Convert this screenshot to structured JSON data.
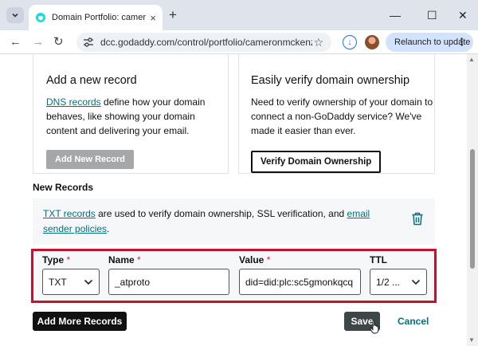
{
  "browser": {
    "tab_title": "Domain Portfolio: cameronmckenzie",
    "tab_close_glyph": "×",
    "new_tab_glyph": "+",
    "window_controls": {
      "minimize": "—",
      "maximize": "☐",
      "close": "✕"
    },
    "url": "dcc.godaddy.com/control/portfolio/cameronmckenzie.co...",
    "relaunch_label": "Relaunch to update",
    "back_glyph": "←",
    "forward_glyph": "→",
    "reload_glyph": "↻",
    "star_glyph": "☆",
    "menu_glyph": "⋮",
    "download_glyph": "↓"
  },
  "cards": {
    "add_record": {
      "title": "Add a new record",
      "link_text": "DNS records",
      "body_rest": " define how your domain behaves, like showing your domain content and delivering your email.",
      "button_label": "Add New Record"
    },
    "verify": {
      "title": "Easily verify domain ownership",
      "body": "Need to verify ownership of your domain to connect a non-GoDaddy service? We've made it easier than ever.",
      "button_label": "Verify Domain Ownership"
    }
  },
  "new_records": {
    "section_title": "New Records",
    "info_link_1": "TXT records",
    "info_text_1": " are used to verify domain ownership, SSL verification, and ",
    "info_link_2": "email sender policies",
    "info_text_2": ".",
    "fields": {
      "type": {
        "label": "Type",
        "required_mark": "*",
        "value": "TXT"
      },
      "name": {
        "label": "Name",
        "required_mark": "*",
        "value": "_atproto"
      },
      "value": {
        "label": "Value",
        "required_mark": "*",
        "value": "did=did:plc:sc5gmonkqcq"
      },
      "ttl": {
        "label": "TTL",
        "value": "1/2 ..."
      }
    }
  },
  "actions": {
    "add_more_label": "Add More Records",
    "save_label": "Save",
    "cancel_label": "Cancel"
  },
  "colors": {
    "accent_link": "#00727d",
    "highlight_border": "#c8102e",
    "primary_dark": "#111111",
    "relaunch_bg": "#d3e3fd"
  }
}
